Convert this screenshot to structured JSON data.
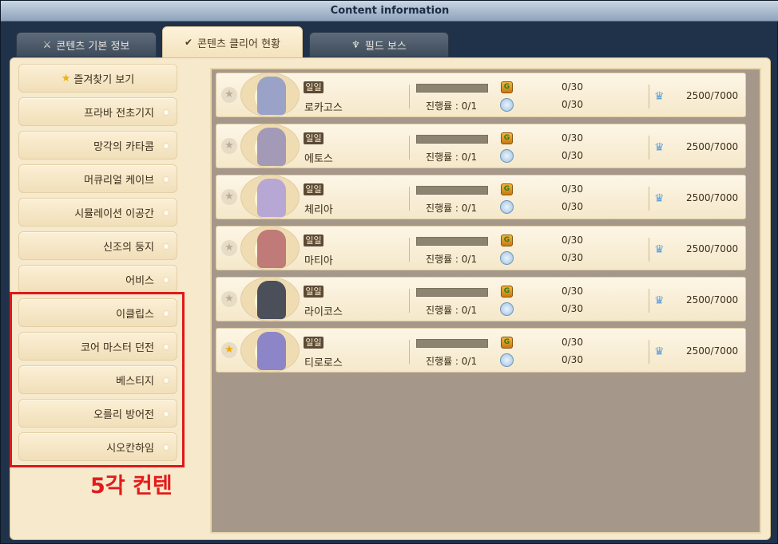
{
  "window": {
    "title": "Content information"
  },
  "tabs": [
    {
      "label": "콘텐츠 기본 정보",
      "icon": "crossed-swords-icon"
    },
    {
      "label": "콘텐츠 클리어 현황",
      "icon": "checkmark-sword-icon"
    },
    {
      "label": "필드 보스",
      "icon": "boss-emblem-icon"
    }
  ],
  "sidebar": {
    "favorites_label": "즐겨찾기 보기",
    "items": [
      {
        "label": "프라바 전초기지"
      },
      {
        "label": "망각의 카타콤"
      },
      {
        "label": "머큐리얼 케이브"
      },
      {
        "label": "시뮬레이션 이공간"
      },
      {
        "label": "신조의 둥지"
      },
      {
        "label": "어비스"
      },
      {
        "label": "이클립스"
      },
      {
        "label": "코어 마스터 던전"
      },
      {
        "label": "베스티지"
      },
      {
        "label": "오를리 방어전"
      },
      {
        "label": "시오칸하임"
      }
    ]
  },
  "annotation": {
    "label": "5각 컨텐",
    "color": "#e01818"
  },
  "bosses": [
    {
      "badge": "일일",
      "name": "로카고스",
      "progress_label": "진행률 : 0/1",
      "progress": 0,
      "count1": "0/30",
      "count2": "0/30",
      "score": "2500/7000",
      "favorite": false,
      "color": "#9aa2c8"
    },
    {
      "badge": "일일",
      "name": "에토스",
      "progress_label": "진행률 : 0/1",
      "progress": 0,
      "count1": "0/30",
      "count2": "0/30",
      "score": "2500/7000",
      "favorite": false,
      "color": "#a39ab8"
    },
    {
      "badge": "일일",
      "name": "체리아",
      "progress_label": "진행률 : 0/1",
      "progress": 0,
      "count1": "0/30",
      "count2": "0/30",
      "score": "2500/7000",
      "favorite": false,
      "color": "#b7a7d4"
    },
    {
      "badge": "일일",
      "name": "마티아",
      "progress_label": "진행률 : 0/1",
      "progress": 0,
      "count1": "0/30",
      "count2": "0/30",
      "score": "2500/7000",
      "favorite": false,
      "color": "#c07a78"
    },
    {
      "badge": "일일",
      "name": "라이코스",
      "progress_label": "진행률 : 0/1",
      "progress": 0,
      "count1": "0/30",
      "count2": "0/30",
      "score": "2500/7000",
      "favorite": false,
      "color": "#4b4f5a"
    },
    {
      "badge": "일일",
      "name": "티로로스",
      "progress_label": "진행률 : 0/1",
      "progress": 0,
      "count1": "0/30",
      "count2": "0/30",
      "score": "2500/7000",
      "favorite": true,
      "color": "#8c86c8"
    }
  ]
}
